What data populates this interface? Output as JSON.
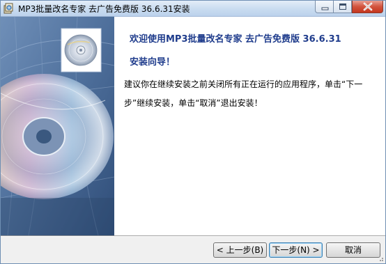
{
  "window": {
    "title": "MP3批量改名专家 去广告免费版 36.6.31安装"
  },
  "content": {
    "welcome_title": "欢迎使用MP3批量改名专家 去广告免费版 36.6.31",
    "subtitle": "安装向导！",
    "instructions": "建议你在继续安装之前关闭所有正在运行的应用程序，单击“下一步”继续安装，单击“取消”退出安装！"
  },
  "buttons": {
    "back": "< 上一步(B)",
    "next": "下一步(N) >",
    "cancel": "取消"
  },
  "icons": {
    "app": "installer-icon",
    "side_panel": "cd-disc-image",
    "minimize": "minimize-icon",
    "maximize": "maximize-icon",
    "close": "close-icon"
  },
  "colors": {
    "heading": "#1f3c8c",
    "side_panel_base": "#3f5e86",
    "close_button": "#c4361f"
  }
}
